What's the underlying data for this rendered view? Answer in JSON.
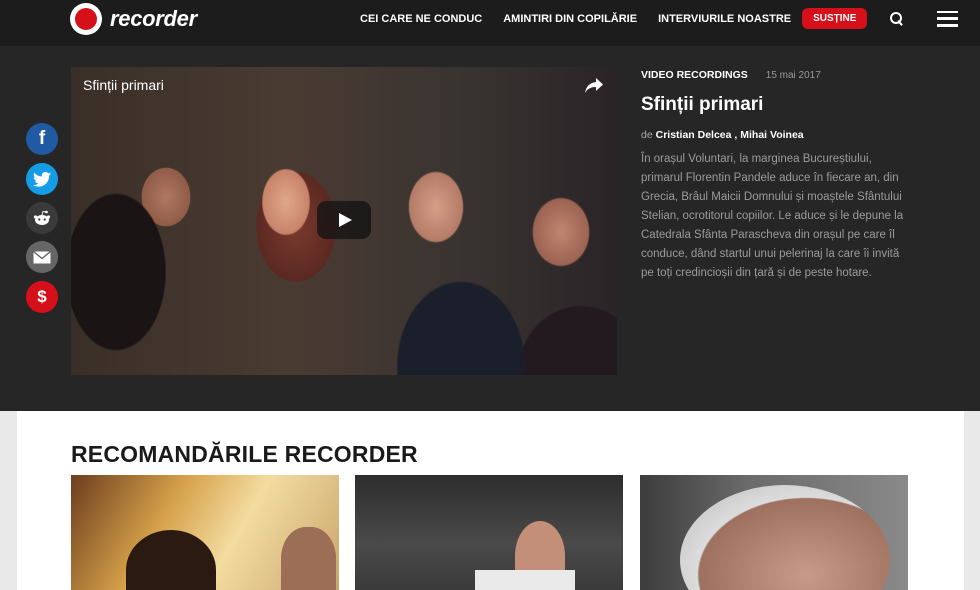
{
  "header": {
    "logo_text": "recorder",
    "nav": [
      "CEI CARE NE CONDUC",
      "AMINTIRI DIN COPILĂRIE",
      "INTERVIURILE NOASTRE"
    ],
    "support_label": "SUSȚINE",
    "icons": [
      "search-icon",
      "menu-icon"
    ]
  },
  "social": {
    "items": [
      {
        "name": "facebook",
        "glyph": "f"
      },
      {
        "name": "twitter",
        "glyph": ""
      },
      {
        "name": "reddit",
        "glyph": ""
      },
      {
        "name": "email",
        "glyph": ""
      },
      {
        "name": "donate",
        "glyph": "$"
      }
    ]
  },
  "video": {
    "title": "Sfinții primari"
  },
  "article": {
    "category": "VIDEO RECORDINGS",
    "date": "15 mai 2017",
    "title": "Sfinții primari",
    "by_label": "de",
    "author1": "Cristian Delcea",
    "author_sep": " , ",
    "author2": "Mihai Voinea",
    "summary": "În orașul Voluntari, la marginea Bucureștiului, primarul Florentin Pandele aduce în fiecare an, din Grecia, Brâul Maicii Domnului și moaștele Sfântului Stelian, ocrotitorul copiilor. Le aduce și le depune la Catedrala Sfânta Parascheva din orașul pe care îl conduce, dând startul unui pelerinaj la care îi invită pe toți credincioșii din țară și de peste hotare."
  },
  "recommendations": {
    "title": "RECOMANDĂRILE RECORDER"
  },
  "colors": {
    "brand_red": "#d6101a",
    "topbar": "#1c1c1c",
    "hero_bg": "#262626"
  }
}
